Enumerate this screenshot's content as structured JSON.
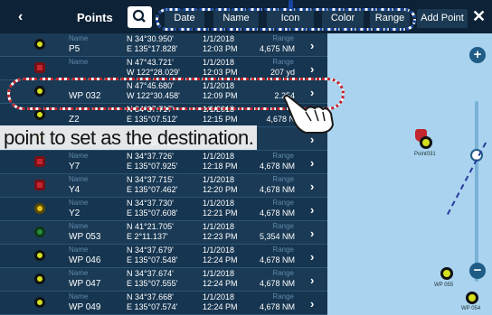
{
  "topbar": {
    "back_icon": "chevron-left-icon",
    "title": "Points",
    "search_icon": "search-icon",
    "buttons": [
      "Date",
      "Name",
      "Icon",
      "Color",
      "Range"
    ],
    "add_point": "Add Point",
    "close_icon": "close-icon"
  },
  "list": {
    "rows": [
      {
        "icon": "yellow",
        "name_label": "Name",
        "name": "P5",
        "lat": "N 34°30.950'",
        "lon": "E 135°17.828'",
        "date": "1/1/2018",
        "time": "12:03 PM",
        "range_label": "Range",
        "range": "4,675 NM"
      },
      {
        "icon": "red",
        "name_label": "Name",
        "name": "",
        "lat": "N 47°43.721'",
        "lon": "W 122°28.029'",
        "date": "1/1/2018",
        "time": "12:03 PM",
        "range_label": "Range",
        "range": "207 yd"
      },
      {
        "icon": "yellow",
        "name_label": "",
        "name": "WP 032",
        "lat": "N 47°45.680'",
        "lon": "W 122°30.458'",
        "date": "1/1/2018",
        "time": "12:09 PM",
        "range_label": "",
        "range": "2.254"
      },
      {
        "icon": "yellow",
        "name_label": "",
        "name": "Z2",
        "lat": "N 34°37.717'",
        "lon": "E 135°07.512'",
        "date": "1/1/2018",
        "time": "12:15 PM",
        "range_label": "",
        "range": "4,678 N"
      },
      {
        "icon": "yellow",
        "name_label": "",
        "name": "",
        "lat": "",
        "lon": "E 135°07.925'",
        "date": "",
        "time": "",
        "range_label": "",
        "range": ""
      },
      {
        "icon": "red",
        "name_label": "Name",
        "name": "Y7",
        "lat": "N 34°37.726'",
        "lon": "E 135°07.925'",
        "date": "1/1/2018",
        "time": "12:18 PM",
        "range_label": "Range",
        "range": "4,678 NM"
      },
      {
        "icon": "red",
        "name_label": "Name",
        "name": "Y4",
        "lat": "N 34°37.715'",
        "lon": "E 135°07.462'",
        "date": "1/1/2018",
        "time": "12:20 PM",
        "range_label": "Range",
        "range": "4,678 NM"
      },
      {
        "icon": "yellow-dot",
        "name_label": "Name",
        "name": "Y2",
        "lat": "N 34°37.730'",
        "lon": "E 135°07.608'",
        "date": "1/1/2018",
        "time": "12:21 PM",
        "range_label": "Range",
        "range": "4,678 NM"
      },
      {
        "icon": "green",
        "name_label": "Name",
        "name": "WP 053",
        "lat": "N 41°21.705'",
        "lon": "E 2°11.137'",
        "date": "1/1/2018",
        "time": "12:23 PM",
        "range_label": "Range",
        "range": "5,354 NM"
      },
      {
        "icon": "yellow",
        "name_label": "Name",
        "name": "WP 046",
        "lat": "N 34°37.679'",
        "lon": "E 135°07.548'",
        "date": "1/1/2018",
        "time": "12:24 PM",
        "range_label": "Range",
        "range": "4,678 NM"
      },
      {
        "icon": "yellow",
        "name_label": "Name",
        "name": "WP 047",
        "lat": "N 34°37.674'",
        "lon": "E 135°07.555'",
        "date": "1/1/2018",
        "time": "12:24 PM",
        "range_label": "Range",
        "range": "4,678 NM"
      },
      {
        "icon": "yellow",
        "name_label": "Name",
        "name": "WP 049",
        "lat": "N 34°37.668'",
        "lon": "E 135°07.574'",
        "date": "1/1/2018",
        "time": "12:24 PM",
        "range_label": "Range",
        "range": "4,678 NM"
      }
    ]
  },
  "map": {
    "waypoints": [
      {
        "label": "Point031"
      },
      {
        "label": "WP 055"
      },
      {
        "label": "WP 054"
      }
    ],
    "zoom_in": "+",
    "zoom_out": "−"
  },
  "callout": "point to set as the destination."
}
